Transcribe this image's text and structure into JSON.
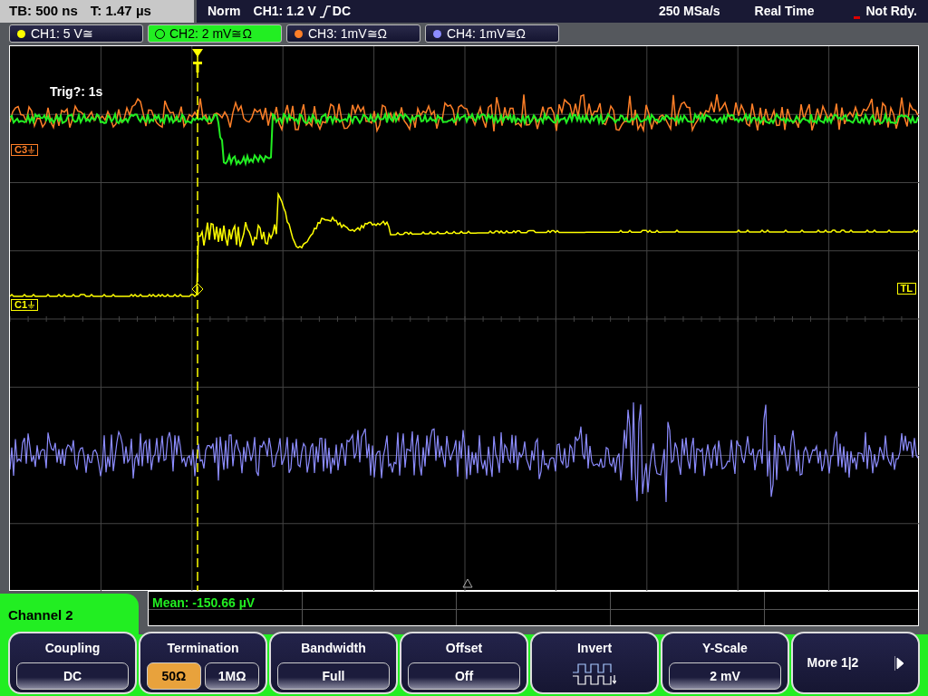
{
  "status_bar": {
    "timebase": "TB: 500 ns",
    "trigger_time": "T: 1.47 µs",
    "mode": "Norm",
    "trigger_source": "CH1: 1.2 V",
    "trigger_coupling": "DC",
    "sample_rate": "250 MSa/s",
    "acquisition": "Real Time",
    "state": "Not Rdy."
  },
  "channels": [
    {
      "label": "CH1: 5 V≅",
      "color": "#ffff00",
      "selected": false
    },
    {
      "label": "CH2: 2 mV≅Ω",
      "color": "#22ee22",
      "selected": true
    },
    {
      "label": "CH3: 1mV≅Ω",
      "color": "#ff7f27",
      "selected": false
    },
    {
      "label": "CH4: 1mV≅Ω",
      "color": "#8c8cff",
      "selected": false
    }
  ],
  "display": {
    "trigger_info": "Trig?: 1s",
    "markers": [
      {
        "label": "C3",
        "kind": "channel"
      },
      {
        "label": "C1",
        "kind": "channel"
      },
      {
        "label": "TL",
        "kind": "level"
      }
    ]
  },
  "measurement": {
    "text": "Mean: -150.66 µV"
  },
  "menu": {
    "title": "Channel 2",
    "softkeys": [
      {
        "kind": "value",
        "title": "Coupling",
        "value": "DC"
      },
      {
        "kind": "options",
        "title": "Termination",
        "options": [
          {
            "label": "50Ω",
            "selected": true
          },
          {
            "label": "1MΩ",
            "selected": false
          }
        ]
      },
      {
        "kind": "value",
        "title": "Bandwidth",
        "value": "Full"
      },
      {
        "kind": "value",
        "title": "Offset",
        "value": "Off"
      },
      {
        "kind": "icon",
        "title": "Invert"
      },
      {
        "kind": "value",
        "title": "Y-Scale",
        "value": "2 mV"
      },
      {
        "kind": "more",
        "title": "More 1|2"
      }
    ]
  }
}
